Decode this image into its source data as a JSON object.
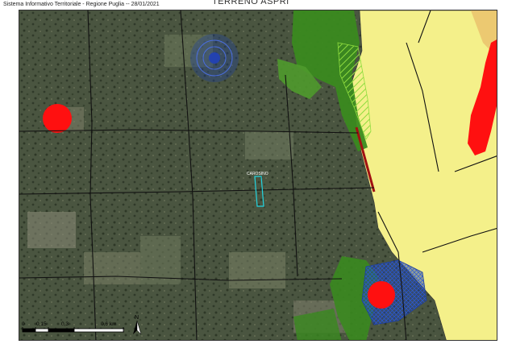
{
  "header": {
    "source": "Sistema Informativo Territoriale - Regione Puglia  -- 28/01/2021",
    "title": "TERRENO ASPRI"
  },
  "map": {
    "parcel_label": "CAROSINO",
    "colors": {
      "satellite_base": "#3f4a35",
      "zone_yellow": "#f4f08a",
      "zone_green": "#3a8a1f",
      "hatch_green": "#7fcf3a",
      "zone_blue": "#1d3e9e",
      "marker_red": "#ff1010",
      "road_line": "#111111",
      "parcel_outline": "#22d4e0"
    }
  },
  "scale_bar": {
    "labels": [
      "0",
      "0,15",
      "0,3",
      "0,6 km"
    ]
  },
  "north_arrow": {
    "label": "N",
    "icon": "north-arrow-icon"
  }
}
